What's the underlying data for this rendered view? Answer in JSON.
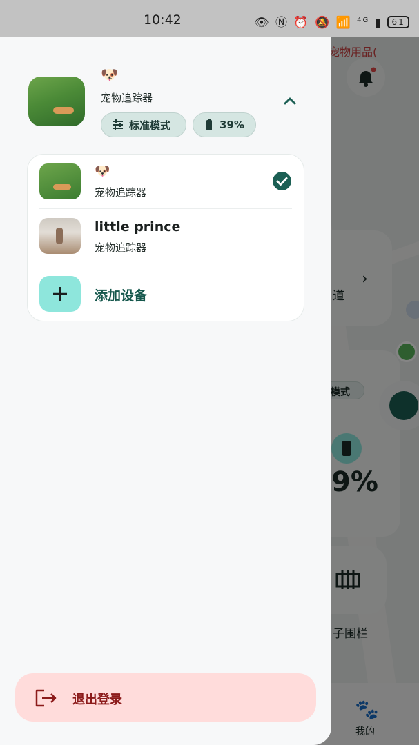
{
  "status_bar": {
    "time": "10:42",
    "icons": [
      "eye-icon",
      "nfc-icon",
      "alarm-off-icon",
      "mute-icon",
      "wifi-icon",
      "signal-icon"
    ],
    "network_label": "4G",
    "battery_level": "61"
  },
  "background": {
    "top_text": "宠物用品(",
    "partial_label_1": "道",
    "mode_chip_partial": "模式",
    "battery_partial": "9%",
    "fence_partial": "子围栏",
    "nav_mine_label": "我的"
  },
  "drawer": {
    "current_device": {
      "emoji": "🐶",
      "name": "宠物追踪器",
      "mode_chip_label": "标准模式",
      "battery_chip_label": "39%"
    },
    "devices": [
      {
        "emoji": "🐶",
        "title": "",
        "subtitle": "宠物追踪器",
        "selected": true
      },
      {
        "emoji": "",
        "title": "little prince",
        "subtitle": "宠物追踪器",
        "selected": false
      }
    ],
    "add_device_label": "添加设备",
    "logout_label": "退出登录"
  },
  "colors": {
    "accent_dark": "#1b5f54",
    "chip_bg": "#d5e6e2",
    "add_button_bg": "#8ee6dc",
    "logout_bg": "#ffdcdb",
    "logout_text": "#8c1b1b"
  }
}
